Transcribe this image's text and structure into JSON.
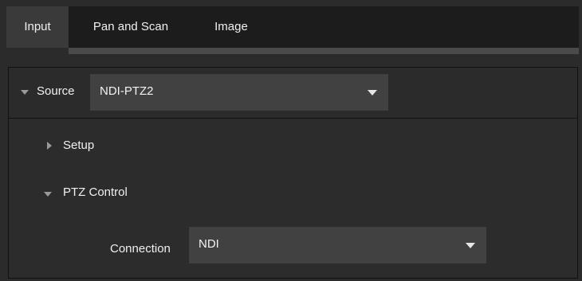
{
  "tabs": [
    {
      "label": "Input",
      "active": true
    },
    {
      "label": "Pan and Scan",
      "active": false
    },
    {
      "label": "Image",
      "active": false
    }
  ],
  "source": {
    "label": "Source",
    "value": "NDI-PTZ2",
    "expanded": true
  },
  "setup": {
    "label": "Setup",
    "expanded": false
  },
  "ptz_control": {
    "label": "PTZ Control",
    "expanded": true
  },
  "connection": {
    "label": "Connection",
    "value": "NDI"
  },
  "colors": {
    "background": "#2b2b2b",
    "tab_bar": "#1c1c1c",
    "active_tab": "#3a3a3a",
    "dropdown": "#414141",
    "text": "#f0f0f0"
  },
  "icons": {
    "source_toggle": "triangle-down-icon",
    "setup_toggle": "triangle-right-icon",
    "ptz_toggle": "triangle-down-icon",
    "dropdown_arrow": "chevron-down-icon"
  }
}
